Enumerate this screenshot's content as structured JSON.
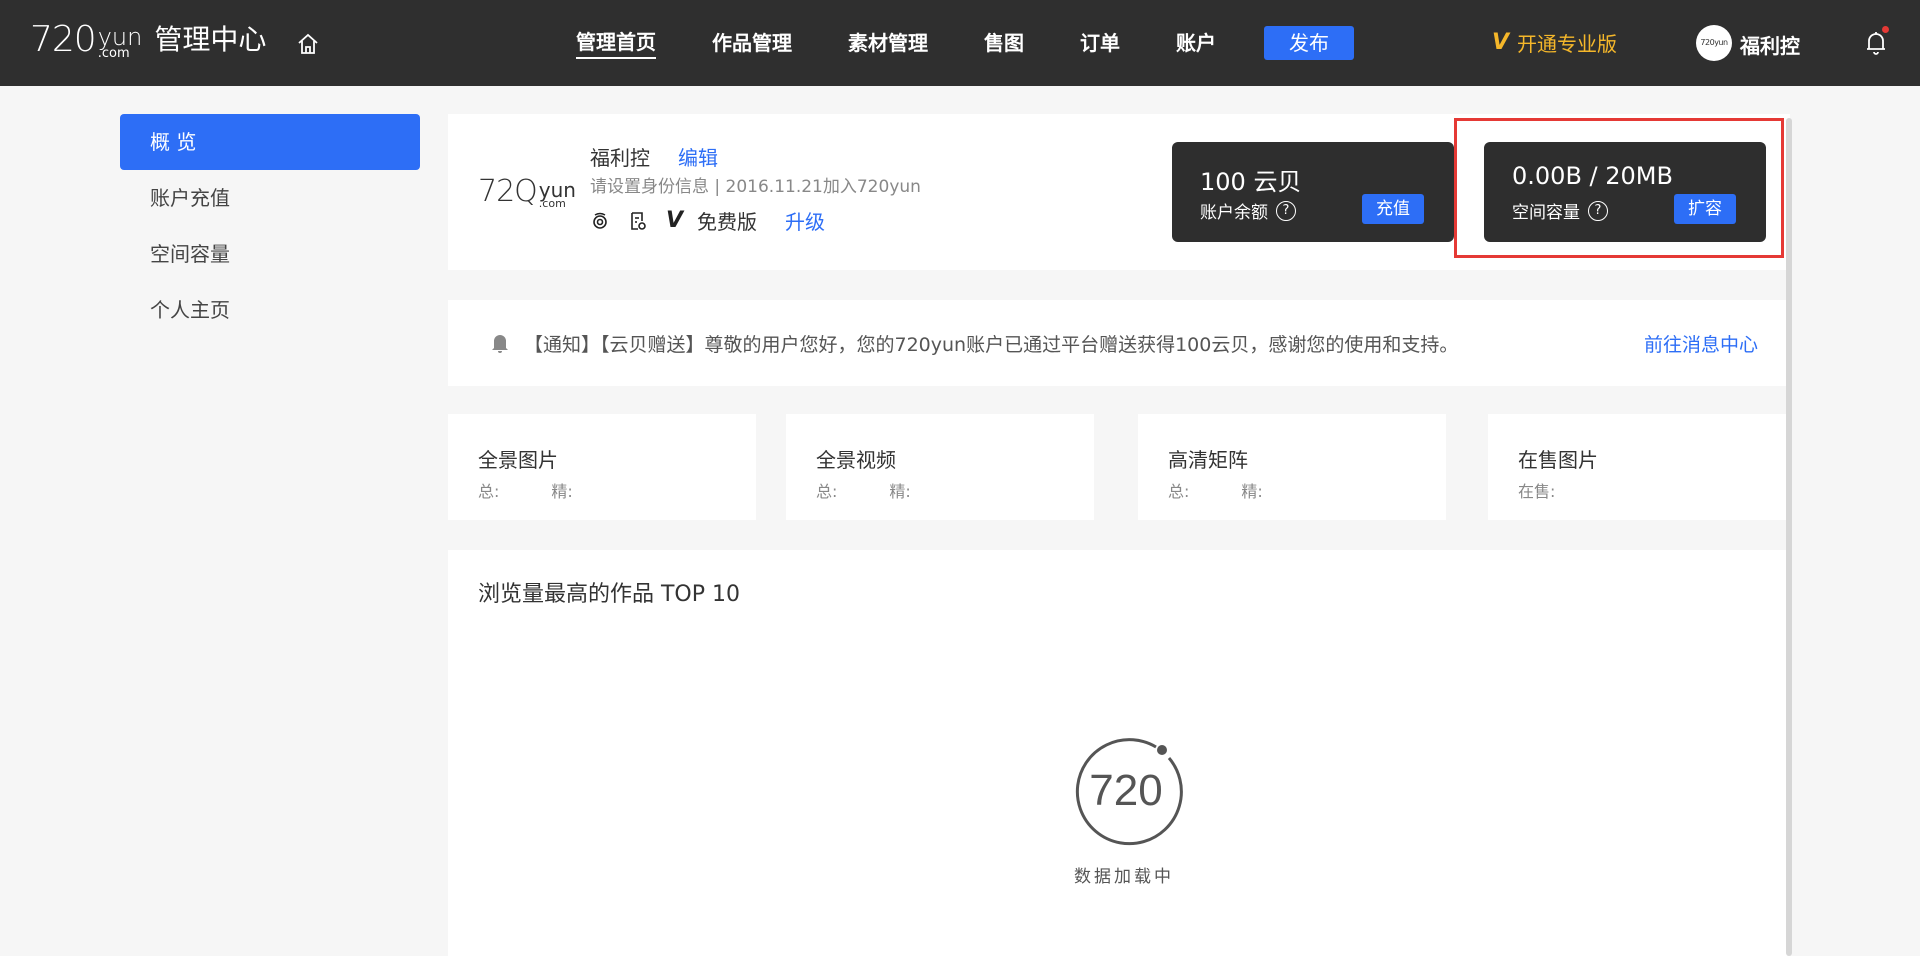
{
  "header": {
    "logo_main": "720",
    "logo_yun": "yun",
    "logo_com": ".com",
    "title": "管理中心",
    "nav": [
      "管理首页",
      "作品管理",
      "素材管理",
      "售图",
      "订单",
      "账户"
    ],
    "publish_label": "发布",
    "pro_v": "V",
    "pro_label": "开通专业版",
    "avatar_text": "720yun",
    "username": "福利控"
  },
  "sidebar": {
    "items": [
      "概 览",
      "账户充值",
      "空间容量",
      "个人主页"
    ]
  },
  "profile": {
    "logo_main": "72Q",
    "logo_yun": "yun",
    "logo_com": ".com",
    "name": "福利控",
    "edit_label": "编辑",
    "info": "请设置身份信息 | 2016.11.21加入720yun",
    "v_mark": "V",
    "plan": "免费版",
    "upgrade_label": "升级"
  },
  "balance": {
    "value": "100 云贝",
    "label": "账户余额",
    "q": "?",
    "button": "充值"
  },
  "space": {
    "value": "0.00B / 20MB",
    "label": "空间容量",
    "q": "?",
    "button": "扩容"
  },
  "notice": {
    "text": "【通知】【云贝赠送】尊敬的用户您好，您的720yun账户已通过平台赠送获得100云贝，感谢您的使用和支持。",
    "link": "前往消息中心"
  },
  "counts": [
    {
      "title": "全景图片",
      "sub1": "总:",
      "sub2": "精:"
    },
    {
      "title": "全景视频",
      "sub1": "总:",
      "sub2": "精:"
    },
    {
      "title": "高清矩阵",
      "sub1": "总:",
      "sub2": "精:"
    },
    {
      "title": "在售图片",
      "sub1": "在售:",
      "sub2": ""
    }
  ],
  "top10": {
    "title": "浏览量最高的作品 TOP 10",
    "loader_mark": "720",
    "loading": "数据加载中"
  },
  "colors": {
    "accent": "#2d6ef6",
    "topbar": "#2f2f2f",
    "pro": "#f5b72a",
    "highlight": "#e53935"
  }
}
